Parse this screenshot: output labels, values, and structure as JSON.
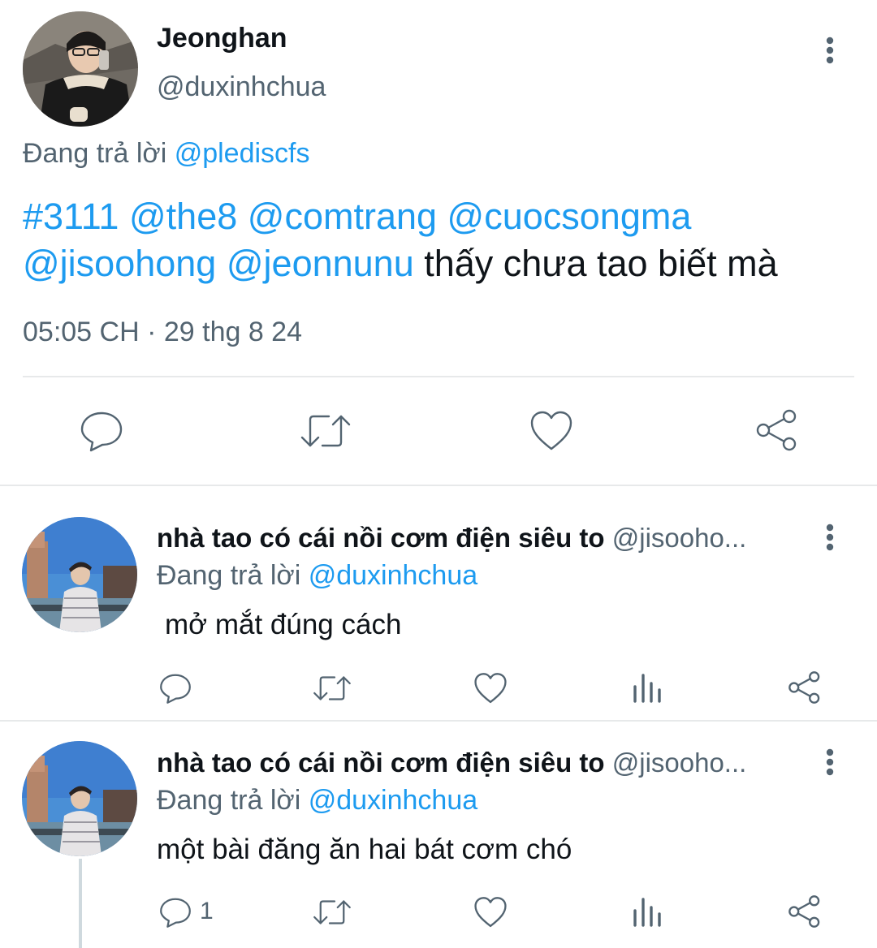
{
  "main_tweet": {
    "name": "Jeonghan",
    "handle": "@duxinhchua",
    "reply_prefix": "Đang trả lời ",
    "reply_to": "@plediscfs",
    "text_links": [
      "#3111",
      "@the8",
      "@comtrang",
      "@cuocsongma",
      "@jisoohong",
      "@jeonnunu"
    ],
    "text_tail": "thấy chưa tao biết mà",
    "timestamp": "05:05 CH · 29 thg 8 24",
    "actions": [
      "reply-icon",
      "retweet-icon",
      "like-icon",
      "share-icon"
    ]
  },
  "replies": [
    {
      "name": "nhà tao có cái nồi cơm điện siêu to",
      "handle": "@jisooho...",
      "reply_prefix": "Đang trả lời ",
      "reply_to": "@duxinhchua",
      "text": "mở mắt đúng cách",
      "reply_count": "",
      "actions": [
        "reply-icon",
        "retweet-icon",
        "like-icon",
        "views-icon",
        "share-icon"
      ]
    },
    {
      "name": "nhà tao có cái nồi cơm điện siêu to",
      "handle": "@jisooho...",
      "reply_prefix": "Đang trả lời ",
      "reply_to": "@duxinhchua",
      "text": "một bài đăng ăn hai bát cơm chó",
      "reply_count": "1",
      "actions": [
        "reply-icon",
        "retweet-icon",
        "like-icon",
        "views-icon",
        "share-icon"
      ]
    }
  ],
  "colors": {
    "link": "#1d9bf0",
    "muted": "#536471",
    "text": "#0f1419",
    "divider": "#e7e9ea"
  }
}
